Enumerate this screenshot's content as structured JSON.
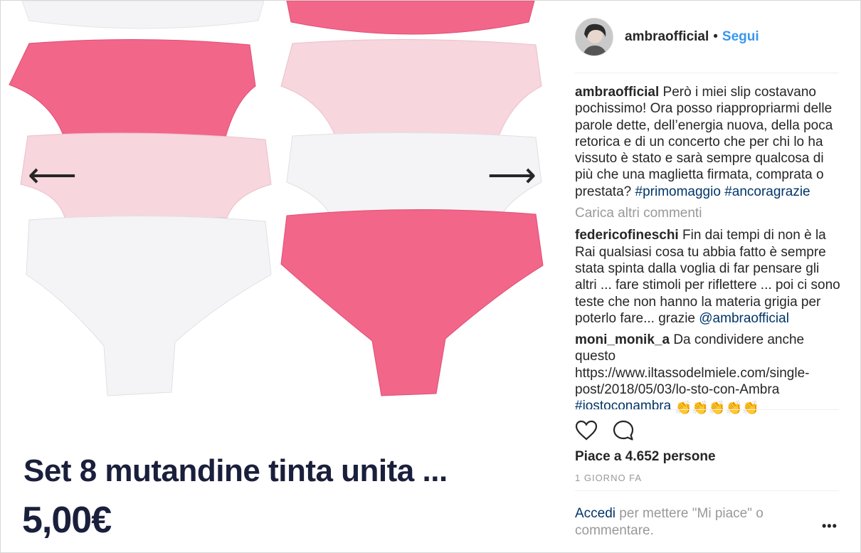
{
  "media": {
    "product_title": "Set 8 mutandine tinta unita ...",
    "product_price": "5,00€",
    "prev_arrow": "⟵",
    "next_arrow": "⟶",
    "colors": {
      "pink": "#f26689",
      "light_pink": "#f7d6dd",
      "white": "#f4f4f6"
    }
  },
  "post": {
    "username": "ambraofficial",
    "separator": "•",
    "follow_label": "Segui",
    "caption": {
      "user": "ambraofficial",
      "text": "Però i miei slip costavano pochissimo! Ora posso riappropriarmi delle parole dette, dell’energia nuova, della poca retorica e di un concerto che per chi lo ha vissuto è stato e sarà sempre qualcosa di più che una maglietta firmata, comprata o prestata?",
      "tags": [
        "#primomaggio",
        "#ancoragrazie"
      ]
    },
    "load_more": "Carica altri commenti",
    "comments": [
      {
        "user": "federicofineschi",
        "text": "Fin dai tempi di non è la Rai qualsiasi cosa tu abbia fatto è sempre stata spinta dalla voglia di far pensare gli altri ... fare stimoli per riflettere ... poi ci sono teste che non hanno la materia grigia per poterlo fare... grazie",
        "mention": "@ambraofficial"
      },
      {
        "user": "moni_monik_a",
        "text": "Da condividere anche questo https://www.iltassodelmiele.com/single-post/2018/05/03/lo-sto-con-Ambra",
        "tag": "#iostoconambra",
        "emoji": "👏👏👏👏👏"
      }
    ],
    "icons": {
      "like": "heart-icon",
      "comment": "comment-icon"
    },
    "likes": "Piace a 4.652 persone",
    "time": "1 GIORNO FA",
    "login_link": "Accedi",
    "login_text": " per mettere \"Mi piace\" o commentare.",
    "more_label": "•••"
  }
}
